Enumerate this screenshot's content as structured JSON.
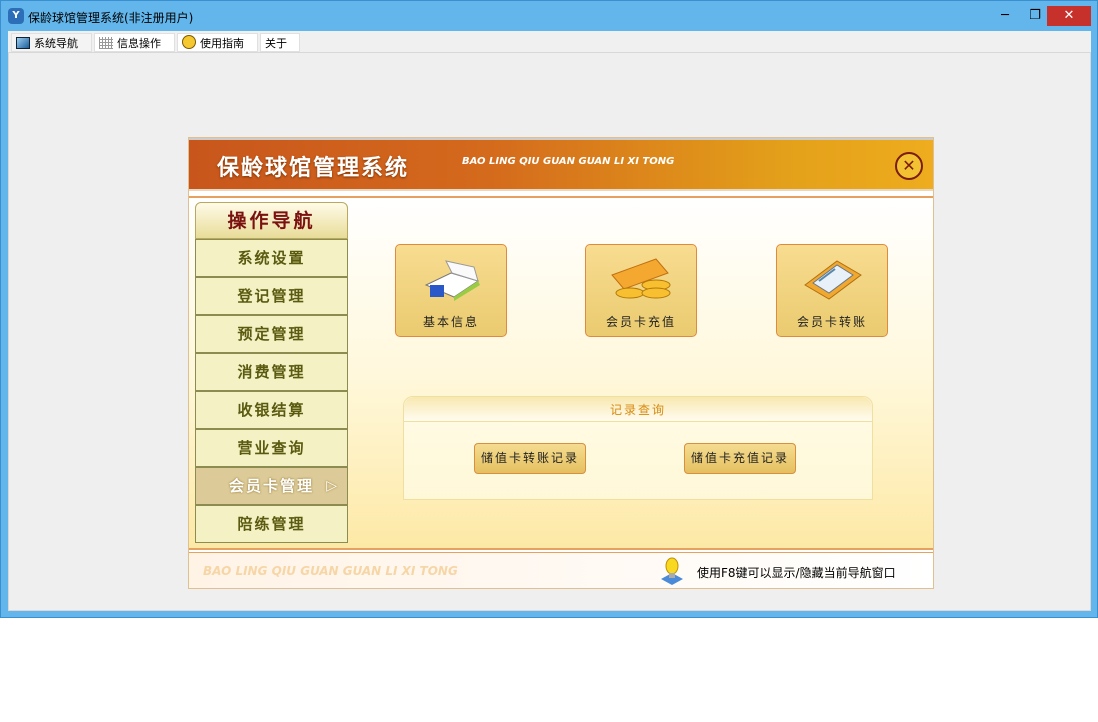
{
  "window": {
    "title": "保龄球馆管理系统(非注册用户)",
    "minimize": "─",
    "restore": "❐",
    "close": "✕"
  },
  "tabs": [
    {
      "label": "系统导航"
    },
    {
      "label": "信息操作"
    },
    {
      "label": "使用指南"
    },
    {
      "label": "关于"
    }
  ],
  "header": {
    "title": "保龄球馆管理系统",
    "subtitle": "BAO LING QIU GUAN GUAN LI XI TONG",
    "close": "✕"
  },
  "nav": {
    "title": "操作导航",
    "items": [
      {
        "label": "系统设置"
      },
      {
        "label": "登记管理"
      },
      {
        "label": "预定管理"
      },
      {
        "label": "消费管理"
      },
      {
        "label": "收银结算"
      },
      {
        "label": "营业查询"
      },
      {
        "label": "会员卡管理",
        "active": true
      },
      {
        "label": "陪练管理"
      }
    ]
  },
  "actions": [
    {
      "label": "基本信息",
      "icon": "book-icon"
    },
    {
      "label": "会员卡充值",
      "icon": "coins-card-icon"
    },
    {
      "label": "会员卡转账",
      "icon": "calculator-icon"
    }
  ],
  "records": {
    "title": "记录查询",
    "buttons": [
      {
        "label": "储值卡转账记录"
      },
      {
        "label": "储值卡充值记录"
      }
    ]
  },
  "footer": {
    "brand": "BAO LING QIU GUAN GUAN LI XI TONG",
    "tip": "使用F8键可以显示/隐藏当前导航窗口"
  },
  "colors": {
    "titlebar": "#62b6ec",
    "header_start": "#c8561c",
    "header_end": "#eeac1e",
    "nav_title": "#7a1010"
  }
}
